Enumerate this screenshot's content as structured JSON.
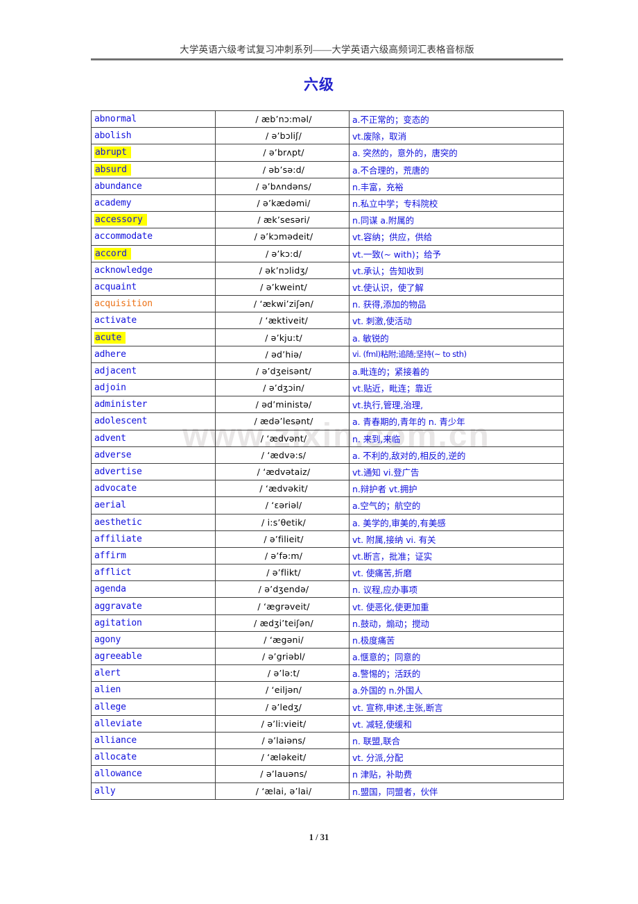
{
  "header": {
    "running_head": "大学英语六级考试复习冲刺系列——大学英语六级高频词汇表格音标版"
  },
  "title": "六级",
  "watermark": "www.zixin.com.cn",
  "footer": {
    "page_label": "1 / 31"
  },
  "colors": {
    "word_blue": "#1111dd",
    "word_orange": "#ec7014",
    "highlight_yellow": "#ffff00",
    "definition_blue": "#1111dd",
    "ipa_black": "#000000",
    "title_blue": "#2222cc",
    "border_gray": "#3f3f3f",
    "watermark_gray": "#e8e6e6"
  },
  "table": {
    "columns": [
      "word",
      "ipa",
      "definition"
    ],
    "rows": [
      {
        "word": "abnormal",
        "ipa": "/ æb’nɔ:məl/",
        "def": "a.不正常的；变态的",
        "highlight": false,
        "color": "blue"
      },
      {
        "word": "abolish",
        "ipa": "/ ə’bɔliʃ/",
        "def": "vt.废除，取消",
        "highlight": false,
        "color": "blue"
      },
      {
        "word": "abrupt",
        "ipa": "/ ə’brʌpt/",
        "def": "a. 突然的，意外的，唐突的",
        "highlight": true,
        "color": "blue"
      },
      {
        "word": "absurd",
        "ipa": "/ əb’sə:d/",
        "def": "a.不合理的，荒唐的",
        "highlight": true,
        "color": "blue"
      },
      {
        "word": "abundance",
        "ipa": "/ ə’bʌndəns/",
        "def": "n.丰富，充裕",
        "highlight": false,
        "color": "blue"
      },
      {
        "word": "academy",
        "ipa": "/ ə’kædəmi/",
        "def": "n.私立中学；专科院校",
        "highlight": false,
        "color": "blue"
      },
      {
        "word": "accessory",
        "ipa": "/ æk’sesəri/",
        "def": "n.同谋 a.附属的",
        "highlight": true,
        "color": "blue"
      },
      {
        "word": "accommodate",
        "ipa": "/ ə’kɔmədeit/",
        "def": "vt.容纳；供应，供给",
        "highlight": false,
        "color": "blue"
      },
      {
        "word": "accord",
        "ipa": "/ ə’kɔ:d/",
        "def": "vt.一致(~ with)；给予",
        "highlight": true,
        "color": "blue"
      },
      {
        "word": "acknowledge",
        "ipa": "/ ək’nɔlidʒ/",
        "def": "vt.承认；告知收到",
        "highlight": false,
        "color": "blue"
      },
      {
        "word": "acquaint",
        "ipa": "/ ə’kweint/",
        "def": "vt.使认识，使了解",
        "highlight": false,
        "color": "blue"
      },
      {
        "word": "acquisition",
        "ipa": "/ ‘ækwi’ziʃən/",
        "def": "n. 获得,添加的物品",
        "highlight": false,
        "color": "orange"
      },
      {
        "word": "activate",
        "ipa": "/ ‘æktiveit/",
        "def": "vt. 刺激,使活动",
        "highlight": false,
        "color": "blue"
      },
      {
        "word": "acute",
        "ipa": "/ ə’kju:t/",
        "def": "a. 敏锐的",
        "highlight": true,
        "color": "blue"
      },
      {
        "word": "adhere",
        "ipa": "/ əd’hiə/",
        "def": "vi. (fml)粘附;追随;坚持(~ to sth)",
        "highlight": false,
        "color": "blue",
        "tight": true
      },
      {
        "word": "adjacent",
        "ipa": "/ ə’dʒeisənt/",
        "def": "a.毗连的；紧接着的",
        "highlight": false,
        "color": "blue"
      },
      {
        "word": "adjoin",
        "ipa": "/ ə’dʒɔin/",
        "def": "vt.贴近，毗连；靠近",
        "highlight": false,
        "color": "blue"
      },
      {
        "word": "administer",
        "ipa": "/ əd’ministə/",
        "def": "vt.执行,管理,治理,",
        "highlight": false,
        "color": "blue"
      },
      {
        "word": "adolescent",
        "ipa": "/ ædə’lesənt/",
        "def": "a. 青春期的,青年的 n. 青少年",
        "highlight": false,
        "color": "blue"
      },
      {
        "word": "advent",
        "ipa": "/ ‘ædvənt/",
        "def": "n. 来到,来临",
        "highlight": false,
        "color": "blue"
      },
      {
        "word": "adverse",
        "ipa": "/  ‘ædvə:s/",
        "def": "a. 不利的,敌对的,相反的,逆的",
        "highlight": false,
        "color": "blue"
      },
      {
        "word": "advertise",
        "ipa": "/  ‘ædvətaiz/",
        "def": "vt.通知 vi.登广告",
        "highlight": false,
        "color": "blue"
      },
      {
        "word": "advocate",
        "ipa": "/  ‘ædvəkit/",
        "def": "n.辩护者 vt.拥护",
        "highlight": false,
        "color": "blue"
      },
      {
        "word": "aerial",
        "ipa": "/  ‘ɛəriəl/",
        "def": "a.空气的；航空的",
        "highlight": false,
        "color": "blue"
      },
      {
        "word": "aesthetic",
        "ipa": "/ i:s’θetik/",
        "def": "a. 美学的,审美的,有美感",
        "highlight": false,
        "color": "blue"
      },
      {
        "word": "affiliate",
        "ipa": "/ ə’filieit/",
        "def": "vt. 附属,接纳 vi. 有关",
        "highlight": false,
        "color": "blue"
      },
      {
        "word": "affirm",
        "ipa": "/ ə’fə:m/",
        "def": "vt.断言，批准；证实",
        "highlight": false,
        "color": "blue"
      },
      {
        "word": "afflict",
        "ipa": "/ ə’flikt/",
        "def": "vt. 使痛苦,折磨",
        "highlight": false,
        "color": "blue"
      },
      {
        "word": "agenda",
        "ipa": "/ ə’dʒendə/",
        "def": "n. 议程,应办事项",
        "highlight": false,
        "color": "blue"
      },
      {
        "word": "aggravate",
        "ipa": "/  ‘ægrəveit/",
        "def": "vt. 使恶化,使更加重",
        "highlight": false,
        "color": "blue"
      },
      {
        "word": "agitation",
        "ipa": "/ ædʒi’teiʃən/",
        "def": "n.鼓动，煽动；搅动",
        "highlight": false,
        "color": "blue"
      },
      {
        "word": "agony",
        "ipa": "/  ‘ægəni/",
        "def": "n.极度痛苦",
        "highlight": false,
        "color": "blue"
      },
      {
        "word": "agreeable",
        "ipa": "/ ə’griəbl/",
        "def": "a.惬意的；同意的",
        "highlight": false,
        "color": "blue"
      },
      {
        "word": "alert",
        "ipa": "/ ə’lə:t/",
        "def": "a.警惕的；活跃的",
        "highlight": false,
        "color": "blue"
      },
      {
        "word": "alien",
        "ipa": "/  ‘eiljən/",
        "def": "a.外国的 n.外国人",
        "highlight": false,
        "color": "blue"
      },
      {
        "word": "allege",
        "ipa": "/ ə’ledʒ/",
        "def": "vt. 宣称,申述,主张,断言",
        "highlight": false,
        "color": "blue"
      },
      {
        "word": "alleviate",
        "ipa": "/ ə’li:vieit/",
        "def": "vt. 减轻,使缓和",
        "highlight": false,
        "color": "blue"
      },
      {
        "word": "alliance",
        "ipa": "/ ə’laiəns/",
        "def": "n. 联盟,联合",
        "highlight": false,
        "color": "blue"
      },
      {
        "word": "allocate",
        "ipa": "/  ‘æləkeit/",
        "def": "vt. 分派,分配",
        "highlight": false,
        "color": "blue"
      },
      {
        "word": "allowance",
        "ipa": "/ ə’lauəns/",
        "def": "n 津贴，补助费",
        "highlight": false,
        "color": "blue"
      },
      {
        "word": "ally",
        "ipa": "/  ‘ælai, ə’lai/",
        "def": "n.盟国，同盟者，伙伴",
        "highlight": false,
        "color": "blue"
      }
    ]
  }
}
